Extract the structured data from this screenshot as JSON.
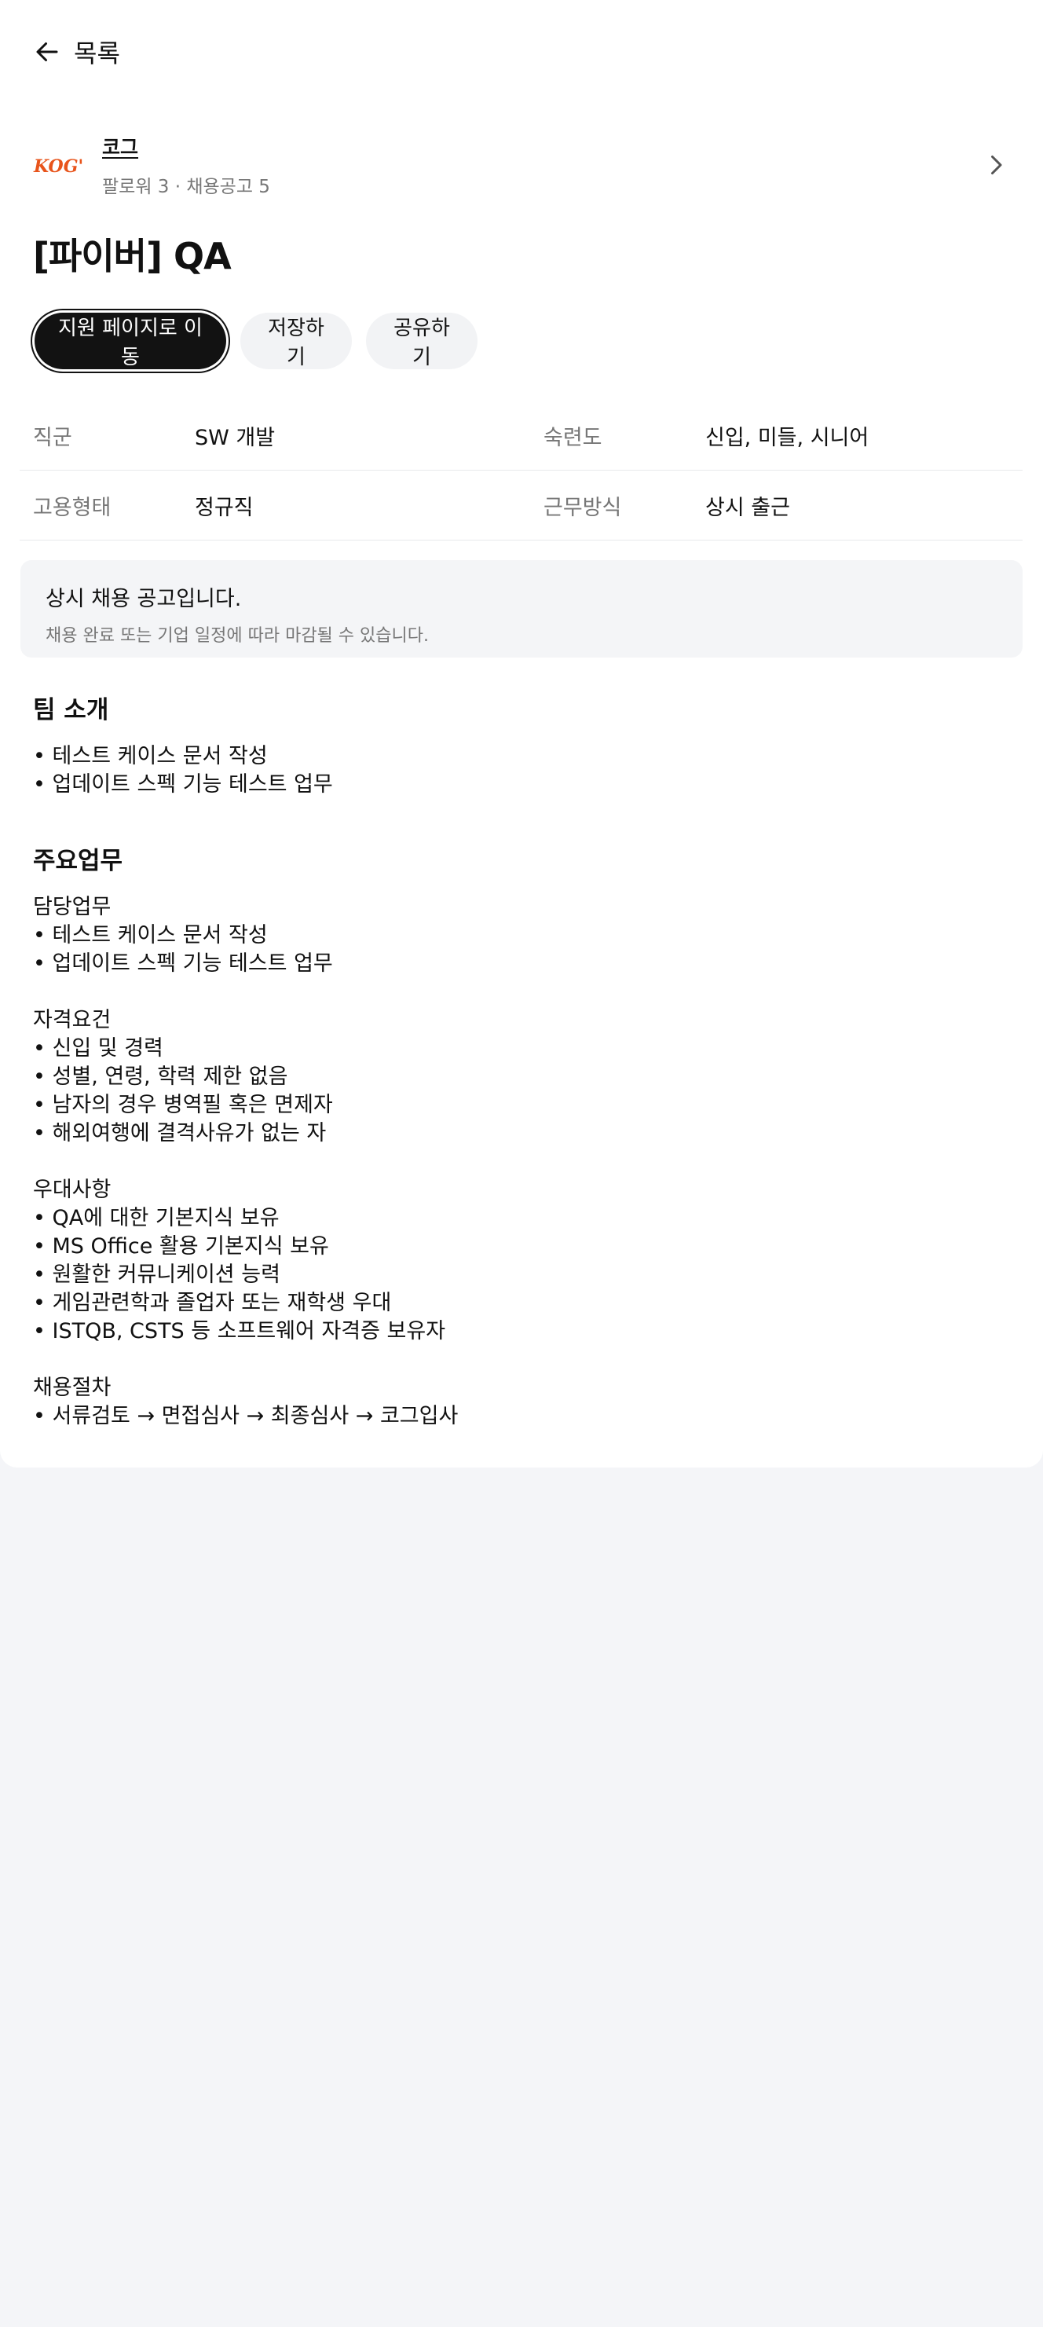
{
  "nav": {
    "back_label": "목록"
  },
  "company": {
    "name": "코그",
    "meta": "팔로워 3 · 채용공고 5",
    "logo_text": "KOG'",
    "brand_color": "#e8541b"
  },
  "job": {
    "title": "[파이버] QA"
  },
  "actions": {
    "apply_label": "지원 페이지로 이동",
    "save_label": "저장하기",
    "share_label": "공유하기"
  },
  "details": [
    {
      "label": "직군",
      "value": "SW 개발",
      "label2": "숙련도",
      "value2": "신입, 미들, 시니어"
    },
    {
      "label": "고용형태",
      "value": "정규직",
      "label2": "근무방식",
      "value2": "상시 출근"
    }
  ],
  "notice": {
    "title": "상시 채용 공고입니다.",
    "subtitle": "채용 완료 또는 기업 일정에 따라 마감될 수 있습니다."
  },
  "team": {
    "heading": "팀 소개",
    "lines": [
      "• 테스트 케이스 문서 작성",
      "• 업데이트 스펙 기능 테스트 업무"
    ]
  },
  "duties": {
    "heading": "주요업무",
    "blocks": [
      {
        "title": "담당업무",
        "lines": [
          "• 테스트 케이스 문서 작성",
          "• 업데이트 스펙 기능 테스트 업무"
        ]
      },
      {
        "title": "자격요건",
        "lines": [
          "• 신입 및 경력",
          "• 성별, 연령, 학력 제한 없음",
          "• 남자의 경우 병역필 혹은 면제자",
          "• 해외여행에 결격사유가 없는 자"
        ]
      },
      {
        "title": "우대사항",
        "lines": [
          "• QA에 대한 기본지식 보유",
          "• MS Office 활용 기본지식 보유",
          "• 원활한 커뮤니케이션 능력",
          "• 게임관련학과 졸업자 또는 재학생 우대",
          "• ISTQB, CSTS 등 소프트웨어 자격증 보유자"
        ]
      },
      {
        "title": "채용절차",
        "lines": [
          "• 서류검토 → 면접심사 → 최종심사 → 코그입사"
        ]
      }
    ]
  }
}
